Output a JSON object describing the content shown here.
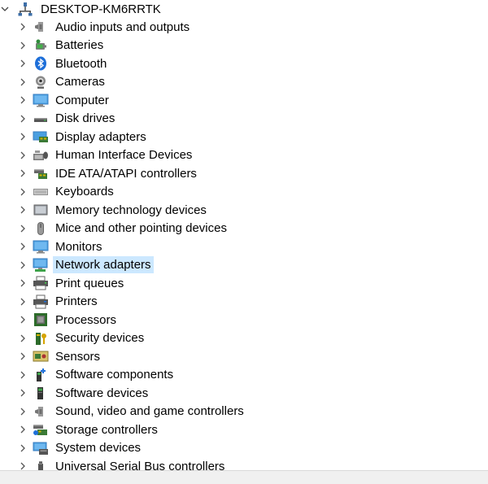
{
  "root": {
    "label": "DESKTOP-KM6RRTK",
    "icon": "computer-icon",
    "expanded": true
  },
  "categories": [
    {
      "label": "Audio inputs and outputs",
      "icon": "speaker-icon"
    },
    {
      "label": "Batteries",
      "icon": "battery-icon"
    },
    {
      "label": "Bluetooth",
      "icon": "bluetooth-icon"
    },
    {
      "label": "Cameras",
      "icon": "camera-icon"
    },
    {
      "label": "Computer",
      "icon": "monitor-icon"
    },
    {
      "label": "Disk drives",
      "icon": "disk-drive-icon"
    },
    {
      "label": "Display adapters",
      "icon": "display-adapter-icon"
    },
    {
      "label": "Human Interface Devices",
      "icon": "hid-icon"
    },
    {
      "label": "IDE ATA/ATAPI controllers",
      "icon": "ide-controller-icon"
    },
    {
      "label": "Keyboards",
      "icon": "keyboard-icon"
    },
    {
      "label": "Memory technology devices",
      "icon": "memory-icon"
    },
    {
      "label": "Mice and other pointing devices",
      "icon": "mouse-icon"
    },
    {
      "label": "Monitors",
      "icon": "monitor-icon"
    },
    {
      "label": "Network adapters",
      "icon": "network-adapter-icon",
      "selected": true
    },
    {
      "label": "Print queues",
      "icon": "print-queue-icon"
    },
    {
      "label": "Printers",
      "icon": "printer-icon"
    },
    {
      "label": "Processors",
      "icon": "processor-icon"
    },
    {
      "label": "Security devices",
      "icon": "security-device-icon"
    },
    {
      "label": "Sensors",
      "icon": "sensor-icon"
    },
    {
      "label": "Software components",
      "icon": "software-component-icon"
    },
    {
      "label": "Software devices",
      "icon": "software-device-icon"
    },
    {
      "label": "Sound, video and game controllers",
      "icon": "speaker-icon"
    },
    {
      "label": "Storage controllers",
      "icon": "storage-controller-icon"
    },
    {
      "label": "System devices",
      "icon": "system-device-icon"
    },
    {
      "label": "Universal Serial Bus controllers",
      "icon": "usb-icon"
    }
  ],
  "colors": {
    "selection": "#cce8ff",
    "statusbar": "#f0f0f0"
  }
}
